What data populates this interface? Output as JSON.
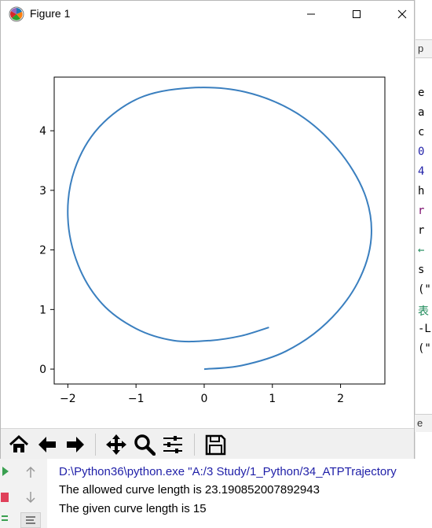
{
  "window": {
    "title": "Figure 1"
  },
  "toolbar": {
    "icons": [
      "home-icon",
      "back-arrow-icon",
      "forward-arrow-icon",
      "pan-icon",
      "zoom-icon",
      "configure-subplots-icon",
      "save-icon"
    ]
  },
  "chart_data": {
    "type": "line",
    "title": "",
    "xlabel": "",
    "ylabel": "",
    "xlim": [
      -2.2,
      2.65
    ],
    "ylim": [
      -0.25,
      4.9
    ],
    "xticks": [
      -2,
      -1,
      0,
      1,
      2
    ],
    "yticks": [
      0,
      1,
      2,
      3,
      4
    ],
    "xtick_labels": [
      "−2",
      "−1",
      "0",
      "1",
      "2"
    ],
    "ytick_labels": [
      "0",
      "1",
      "2",
      "3",
      "4"
    ],
    "grid": false,
    "color": "#3a7fbf",
    "series": [
      {
        "x": [
          0,
          0.55,
          1.2,
          1.8,
          2.25,
          2.45,
          2.35,
          1.95,
          1.35,
          0.6,
          -0.2,
          -0.95,
          -1.55,
          -1.9,
          -2.0,
          -1.85,
          -1.5,
          -1.0,
          -0.45,
          0.1,
          0.55,
          0.95
        ],
        "y": [
          0,
          0.06,
          0.3,
          0.78,
          1.45,
          2.2,
          2.95,
          3.7,
          4.3,
          4.65,
          4.72,
          4.55,
          4.05,
          3.35,
          2.55,
          1.75,
          1.1,
          0.68,
          0.48,
          0.48,
          0.56,
          0.7
        ]
      }
    ]
  },
  "console": {
    "lines": [
      {
        "text": "D:\\Python36\\python.exe \"A:/3 Study/1_Python/34_ATPTrajectory",
        "color": "#1f1fa8"
      },
      {
        "text": "The allowed curve length is 23.190852007892943",
        "color": "#000000"
      },
      {
        "text": "The given curve length is 15",
        "color": "#000000"
      }
    ]
  },
  "ide": {
    "tab_fragment": "p",
    "code_fragments": [
      {
        "text": "e",
        "color": "#000000"
      },
      {
        "text": "a",
        "color": "#000000"
      },
      {
        "text": "c",
        "color": "#000000"
      },
      {
        "text": "0",
        "color": "#1f1fa8"
      },
      {
        "text": "4",
        "color": "#1f1fa8"
      },
      {
        "text": "h",
        "color": "#000000"
      },
      {
        "text": "r",
        "color": "#7a0a6c"
      },
      {
        "text": "r",
        "color": "#000000"
      },
      {
        "text": "←",
        "color": "#1e8a5a"
      },
      {
        "text": "s",
        "color": "#000000"
      },
      {
        "text": "(\"",
        "color": "#000000"
      },
      {
        "text": "表",
        "color": "#1e8a5a"
      },
      {
        "text": "-L",
        "color": "#000000"
      },
      {
        "text": "(\"",
        "color": "#000000"
      }
    ],
    "bottom_fragment": "e"
  },
  "colors": {
    "line": "#3a7fbf",
    "console_path": "#1f1fa8",
    "stop_button": "#e0405a",
    "rerun_arrow": "#3aa050"
  }
}
